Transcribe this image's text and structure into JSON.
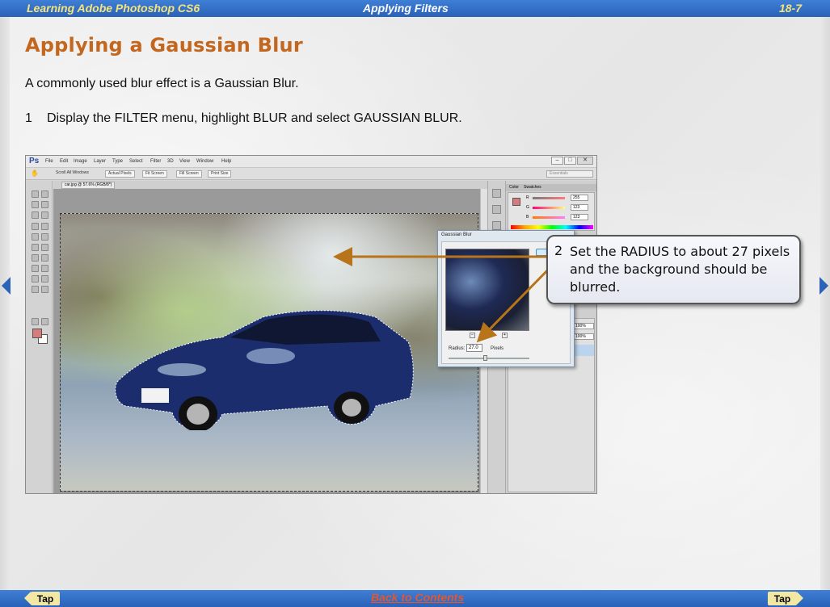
{
  "header": {
    "book_title": "Learning Adobe Photoshop CS6",
    "chapter_title": "Applying Filters",
    "page_number": "18-7"
  },
  "content": {
    "title": "Applying a Gaussian Blur",
    "intro": "A commonly used blur effect is a Gaussian Blur.",
    "step1_number": "1",
    "step1_text": "Display the FILTER menu, highlight BLUR and select GAUSSIAN BLUR.",
    "callout_number": "2",
    "callout_text": "Set the RADIUS to about 27 pixels and the background should be blurred."
  },
  "screenshot": {
    "logo": "Ps",
    "menu": [
      "File",
      "Edit",
      "Image",
      "Layer",
      "Type",
      "Select",
      "Filter",
      "3D",
      "View",
      "Window",
      "Help"
    ],
    "options": {
      "scroll_all_windows": "Scroll All Windows",
      "actual_pixels": "Actual Pixels",
      "fit_screen": "Fit Screen",
      "fill_screen": "Fill Screen",
      "print_size": "Print Size",
      "workspace": "Essentials"
    },
    "doc_tab": "car.jpg @ 57.6% (RGB/8*)",
    "panel_tabs": [
      "Color",
      "Swatches"
    ],
    "color_values": [
      "255",
      "123",
      "123"
    ],
    "color_labels": [
      "R",
      "G",
      "B"
    ],
    "zoom_values": [
      "100%",
      "100%"
    ],
    "dialog": {
      "title": "Gaussian Blur",
      "radius_label": "Radius:",
      "radius_value": "27.0",
      "units": "Pixels"
    }
  },
  "footer": {
    "tap_left": "Tap",
    "back_link": "Back to Contents",
    "tap_right": "Tap"
  },
  "colors": {
    "bar_blue": "#2a62b8",
    "title_orange": "#c4671e",
    "arrow_brown": "#b8741a",
    "header_yellow": "#f4e47a"
  }
}
